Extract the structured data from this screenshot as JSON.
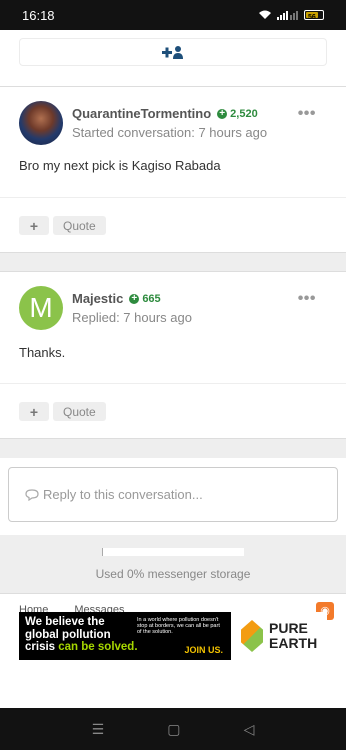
{
  "status_bar": {
    "time": "16:18",
    "signal": "ıll",
    "battery": "56"
  },
  "follow": {
    "icon": "add-user-icon"
  },
  "posts": [
    {
      "author": "QuarantineTormentino",
      "reputation": "2,520",
      "meta": "Started conversation: 7 hours ago",
      "body": "Bro my next pick is Kagiso Rabada",
      "avatar_type": "photo",
      "more_label": "•••",
      "plus_label": "+",
      "quote_label": "Quote"
    },
    {
      "author": "Majestic",
      "reputation": "665",
      "meta": "Replied: 7 hours ago",
      "body": "Thanks.",
      "avatar_letter": "M",
      "more_label": "•••",
      "plus_label": "+",
      "quote_label": "Quote"
    }
  ],
  "reply": {
    "placeholder": "Reply to this conversation..."
  },
  "storage": {
    "label": "Used 0% messenger storage",
    "percent": 0
  },
  "breadcrumbs": [
    "Home",
    "Messages"
  ],
  "ad": {
    "headline_1": "We believe the",
    "headline_2": "global pollution",
    "headline_3": "crisis",
    "headline_highlight": "can be solved.",
    "small_text": "In a world where pollution doesn't stop at borders, we can all be part of the solution.",
    "cta": "JOIN US.",
    "brand_1": "PURE",
    "brand_2": "EARTH"
  },
  "nav": {
    "recents": "☰",
    "home": "▢",
    "back": "◁"
  },
  "colors": {
    "accent": "#1e4f7a",
    "reputation": "#2e8b3e",
    "avatar_m": "#8bc34a"
  }
}
